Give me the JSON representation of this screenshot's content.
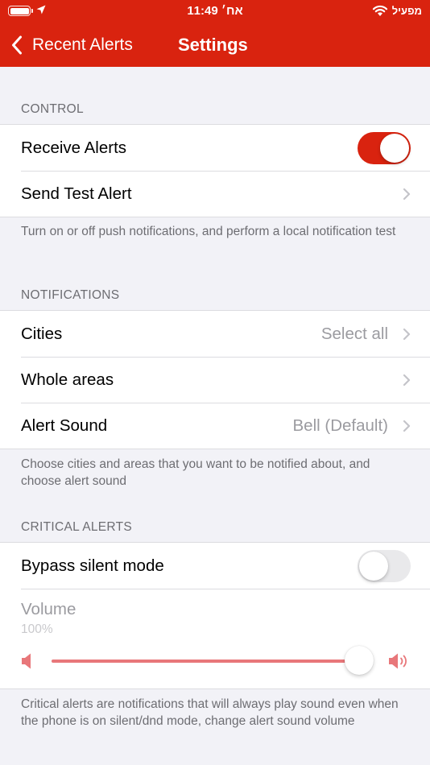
{
  "status_bar": {
    "time": "11:49",
    "day": "אח׳",
    "carrier": "מפעיל"
  },
  "nav": {
    "back_label": "Recent Alerts",
    "title": "Settings"
  },
  "control": {
    "header": "CONTROL",
    "receive_alerts_label": "Receive Alerts",
    "receive_alerts_on": true,
    "send_test_label": "Send Test Alert",
    "footer": "Turn on or off push notifications, and perform a local notification test"
  },
  "notifications": {
    "header": "NOTIFICATIONS",
    "cities_label": "Cities",
    "cities_value": "Select all",
    "whole_areas_label": "Whole areas",
    "alert_sound_label": "Alert Sound",
    "alert_sound_value": "Bell (Default)",
    "footer": "Choose cities and areas that you want to be notified about, and choose alert sound"
  },
  "critical": {
    "header": "CRITICAL ALERTS",
    "bypass_label": "Bypass silent mode",
    "bypass_on": false,
    "volume_label": "Volume",
    "volume_percent": "100%",
    "volume_value": 1.0,
    "footer": "Critical alerts are notifications that will always play sound even when the phone is on silent/dnd mode, change alert sound volume"
  },
  "colors": {
    "accent": "#d9230f",
    "slider_fill": "#e8777a",
    "background": "#f2f2f7"
  },
  "icons": {
    "back": "chevron-left-icon",
    "disclosure": "chevron-right-icon",
    "volume_min": "speaker-icon",
    "volume_max": "speaker-wave-icon",
    "battery": "battery-icon",
    "location": "location-arrow-icon",
    "wifi": "wifi-icon"
  }
}
